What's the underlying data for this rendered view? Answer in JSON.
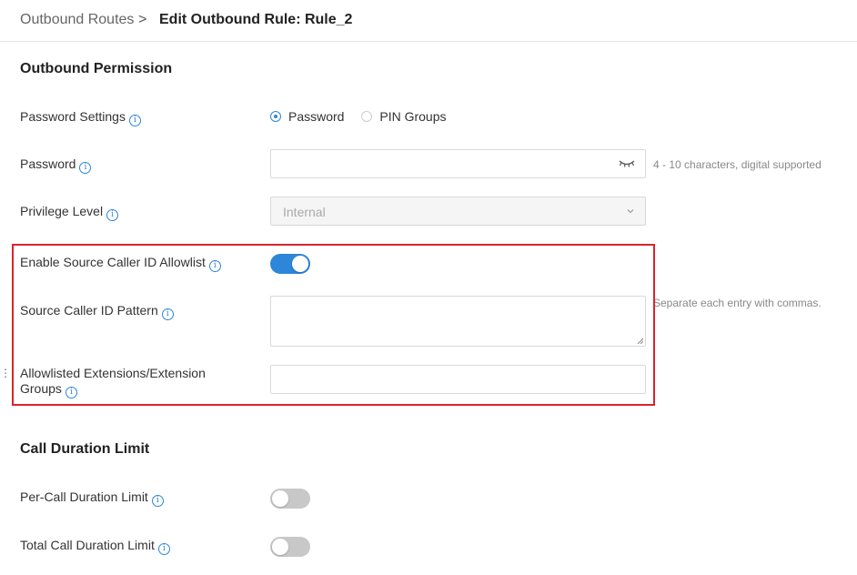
{
  "breadcrumb": {
    "parent": "Outbound Routes",
    "separator": ">",
    "current": "Edit Outbound Rule: Rule_2"
  },
  "sections": {
    "outbound_permission": "Outbound Permission",
    "call_duration_limit": "Call Duration Limit"
  },
  "fields": {
    "password_settings": {
      "label": "Password Settings",
      "options": [
        "Password",
        "PIN Groups"
      ],
      "selected": "Password"
    },
    "password": {
      "label": "Password",
      "value": "",
      "hint": "4 - 10 characters, digital supported",
      "icon": "eye-hidden-icon"
    },
    "privilege_level": {
      "label": "Privilege Level",
      "value": "Internal"
    },
    "enable_allowlist": {
      "label": "Enable Source Caller ID Allowlist",
      "enabled": true
    },
    "source_caller_id_pattern": {
      "label": "Source Caller ID Pattern",
      "value": "",
      "hint": "Separate each entry with commas."
    },
    "allowlisted_extensions": {
      "label_line1": "Allowlisted Extensions/Extension",
      "label_line2": "Groups",
      "value": ""
    },
    "per_call_duration_limit": {
      "label": "Per-Call Duration Limit",
      "enabled": false
    },
    "total_call_duration_limit": {
      "label": "Total Call Duration Limit",
      "enabled": false
    }
  },
  "info_icon_glyph": "i",
  "colors": {
    "accent": "#2d86d9",
    "toggle_on": "#2d86d9",
    "toggle_off": "#c8c8c8",
    "highlight": "#d9232e"
  }
}
